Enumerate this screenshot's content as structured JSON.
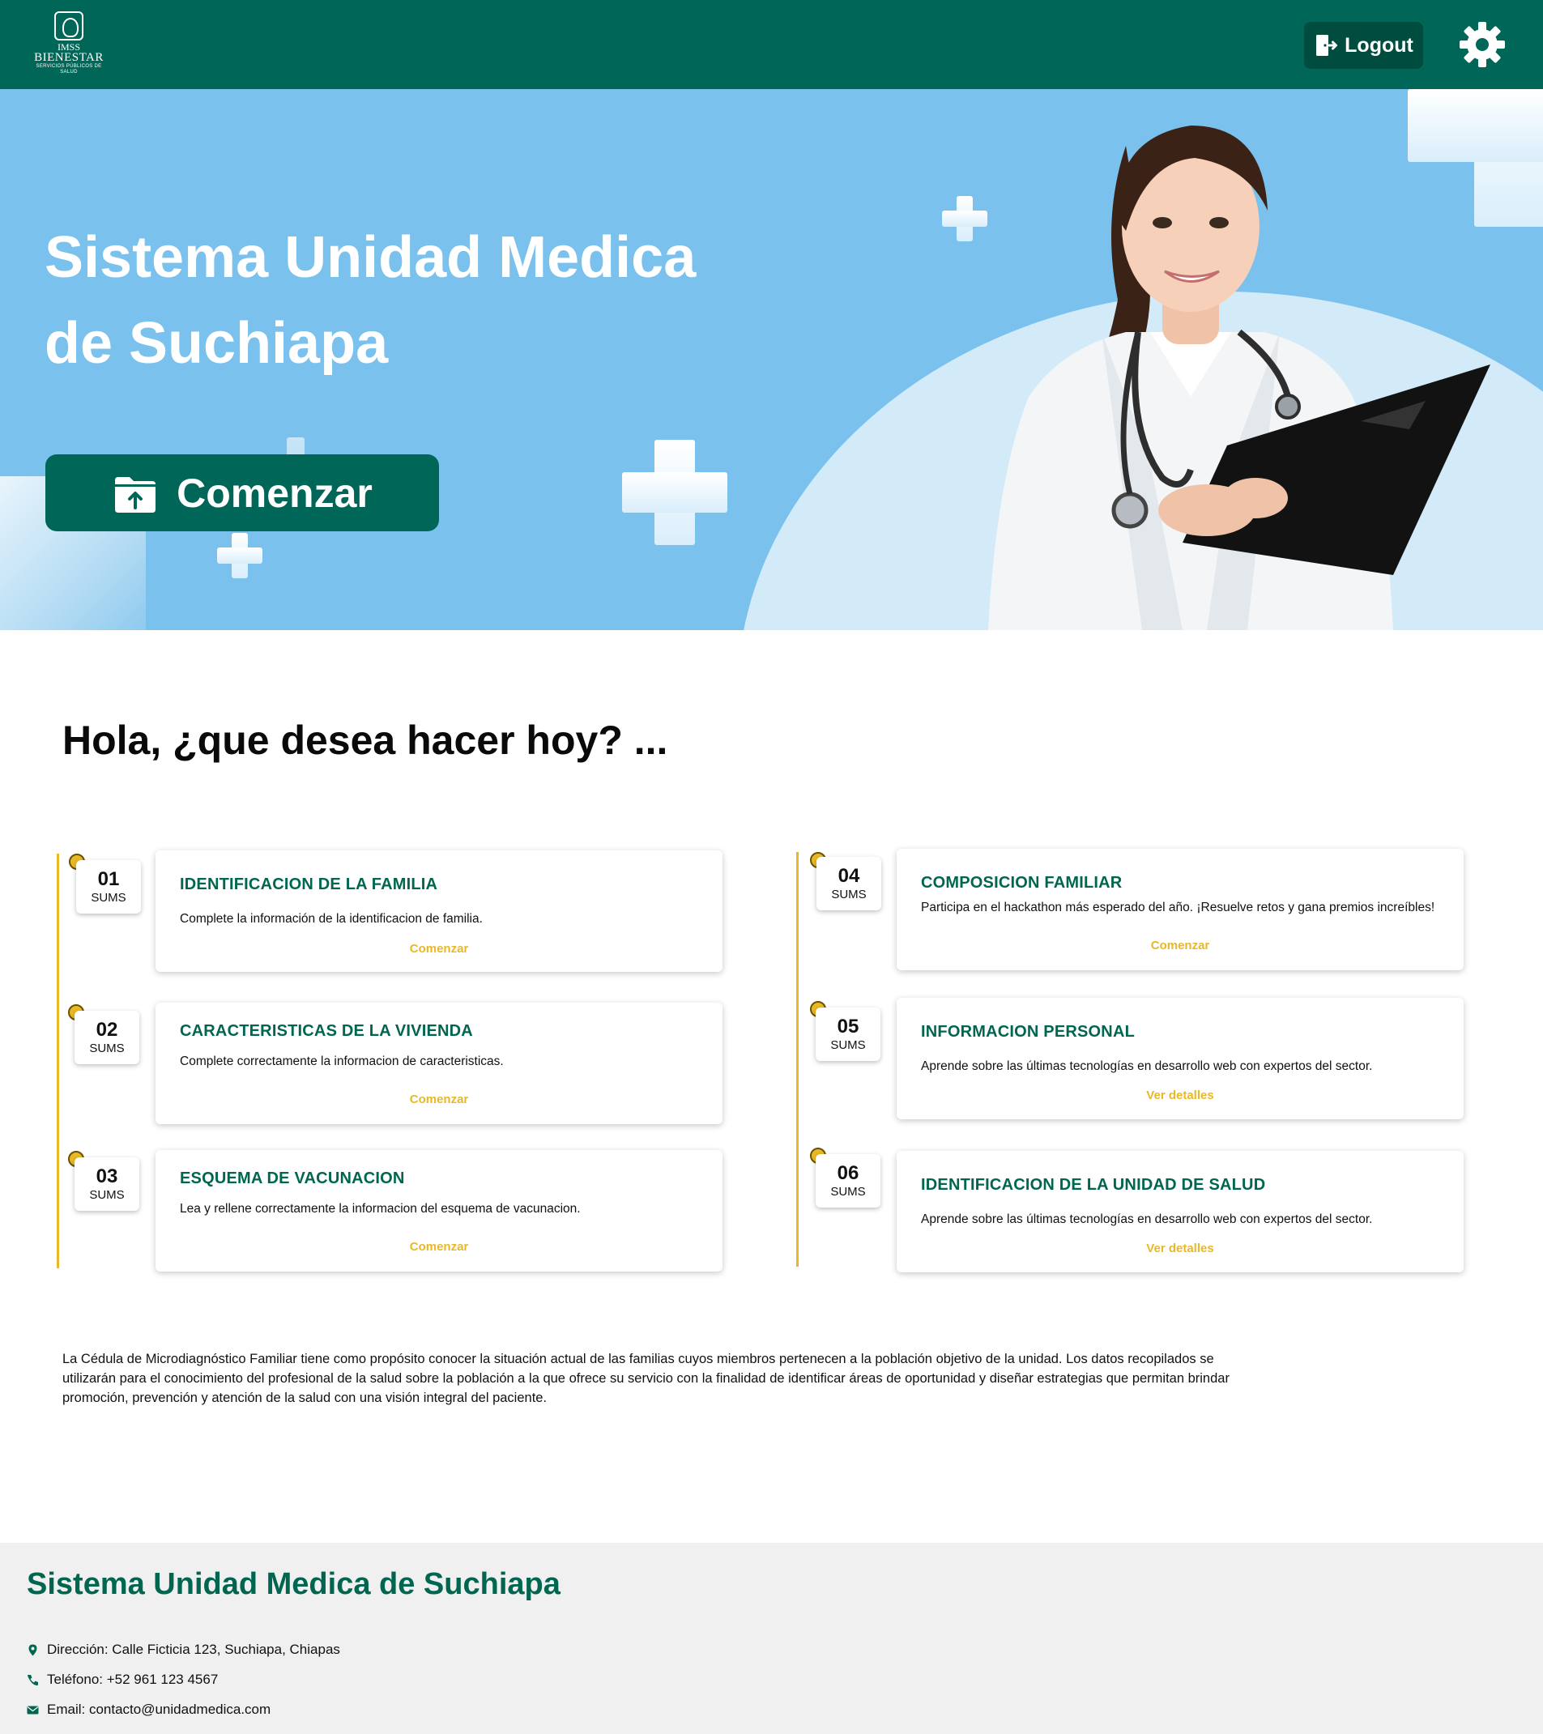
{
  "header": {
    "logo": {
      "line1": "IMSS",
      "line2": "BIENESTAR",
      "line3": "SERVICIOS PÚBLICOS DE SALUD"
    },
    "logout_label": "Logout",
    "settings_icon": "gear-icon"
  },
  "hero": {
    "title_line1": "Sistema Unidad Medica",
    "title_line2": "de Suchiapa",
    "cta_label": "Comenzar",
    "cta_icon": "folder-upload-icon"
  },
  "main": {
    "greeting": "Hola, ¿que desea hacer hoy? ...",
    "steps": [
      {
        "num": "01",
        "unit": "SUMS",
        "title": "IDENTIFICACION DE LA FAMILIA",
        "desc": "Complete la información de la identificacion de familia.",
        "link": "Comenzar"
      },
      {
        "num": "02",
        "unit": "SUMS",
        "title": "CARACTERISTICAS DE LA VIVIENDA",
        "desc": "Complete correctamente la informacion de caracteristicas.",
        "link": "Comenzar"
      },
      {
        "num": "03",
        "unit": "SUMS",
        "title": "ESQUEMA DE VACUNACION",
        "desc": "Lea y rellene correctamente la informacion del esquema de vacunacion.",
        "link": "Comenzar"
      },
      {
        "num": "04",
        "unit": "SUMS",
        "title": "COMPOSICION FAMILIAR",
        "desc": "Participa en el hackathon más esperado del año. ¡Resuelve retos y gana premios increíbles!",
        "link": "Comenzar"
      },
      {
        "num": "05",
        "unit": "SUMS",
        "title": "INFORMACION PERSONAL",
        "desc": "Aprende sobre las últimas tecnologías en desarrollo web con expertos del sector.",
        "link": "Ver detalles"
      },
      {
        "num": "06",
        "unit": "SUMS",
        "title": "IDENTIFICACION DE LA UNIDAD DE SALUD",
        "desc": "Aprende sobre las últimas tecnologías en desarrollo web con expertos del sector.",
        "link": "Ver detalles"
      }
    ],
    "about": "La Cédula de Microdiagnóstico Familiar tiene como propósito conocer la situación actual de las familias cuyos miembros pertenecen a la población objetivo de la unidad. Los datos recopilados se utilizarán para el conocimiento del profesional de la salud sobre la población a la que ofrece su servicio con la finalidad de identificar áreas de oportunidad y diseñar estrategias que permitan brindar promoción, prevención y atención de la salud con una visión integral del paciente."
  },
  "footer": {
    "title": "Sistema Unidad Medica de Suchiapa",
    "address": "Dirección: Calle Ficticia 123, Suchiapa, Chiapas",
    "phone": "Teléfono: +52 961 123 4567",
    "email": "Email: contacto@unidadmedica.com"
  },
  "colors": {
    "primary": "#006657",
    "hero_bg": "#7ac1ed",
    "accent": "#e9b826",
    "footer_bg": "#f0f0f0"
  }
}
